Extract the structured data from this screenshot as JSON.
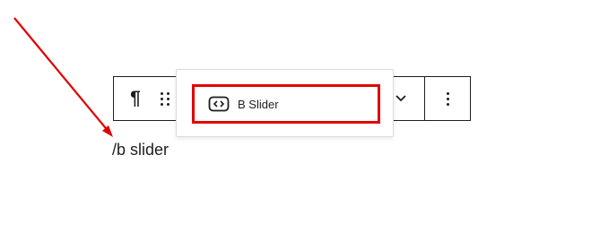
{
  "editor": {
    "typed_text": "/b slider"
  },
  "toolbar": {
    "paragraph_icon": "paragraph-icon",
    "drag_icon": "drag-handle-icon",
    "chevron_icon": "chevron-down-icon",
    "more_icon": "more-vertical-icon"
  },
  "autocomplete": {
    "items": [
      {
        "label": "B Slider",
        "icon": "code-block-icon",
        "highlighted": true
      }
    ]
  },
  "annotation": {
    "arrow_color": "#e00000",
    "highlight_color": "#e00000"
  }
}
